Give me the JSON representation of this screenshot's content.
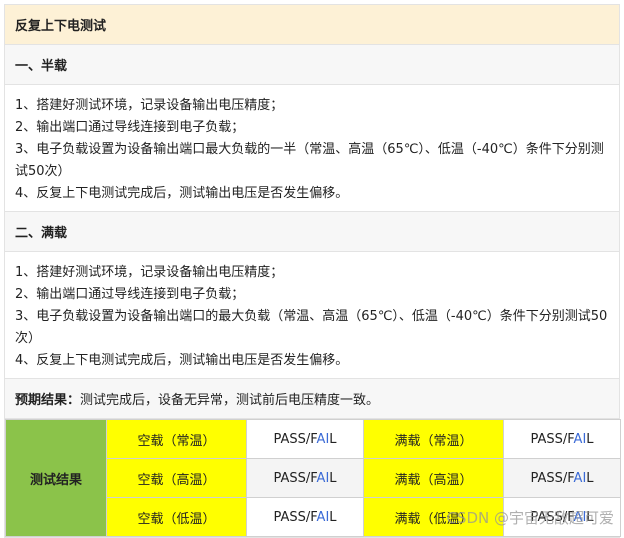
{
  "title": "反复上下电测试",
  "half": {
    "heading": "一、半载",
    "steps": [
      "1、搭建好测试环境，记录设备输出电压精度；",
      "2、输出端口通过导线连接到电子负载；",
      "3、电子负载设置为设备输出端口最大负载的一半（常温、高温（65℃）、低温（-40℃）条件下分别测试50次）",
      "4、反复上下电测试完成后，测试输出电压是否发生偏移。"
    ]
  },
  "full": {
    "heading": "二、满载",
    "steps": [
      "1、搭建好测试环境，记录设备输出电压精度；",
      "2、输出端口通过导线连接到电子负载；",
      "3、电子负载设置为设备输出端口的最大负载（常温、高温（65℃）、低温（-40℃）条件下分别测试50次）",
      "4、反复上下电测试完成后，测试输出电压是否发生偏移。"
    ]
  },
  "expected": {
    "label": "预期结果：",
    "text": "测试完成后，设备无异常，测试前后电压精度一致。"
  },
  "results": {
    "label": "测试结果",
    "pass_prefix": "PASS/F",
    "pass_mid": "AI",
    "pass_suffix": "L",
    "rows": [
      {
        "empty": "空载（常温）",
        "full": "满载（常温）"
      },
      {
        "empty": "空载（高温）",
        "full": "满载（高温）"
      },
      {
        "empty": "空载（低温）",
        "full": "满载（低温）"
      }
    ]
  },
  "watermark": "CSDN @宇宙无敌超可爱",
  "colors": {
    "title_bg": "#fdf1d6",
    "result_label_bg": "#8bc34a",
    "condition_bg": "#ffff00",
    "fail_ai": "#3a6ad6"
  }
}
